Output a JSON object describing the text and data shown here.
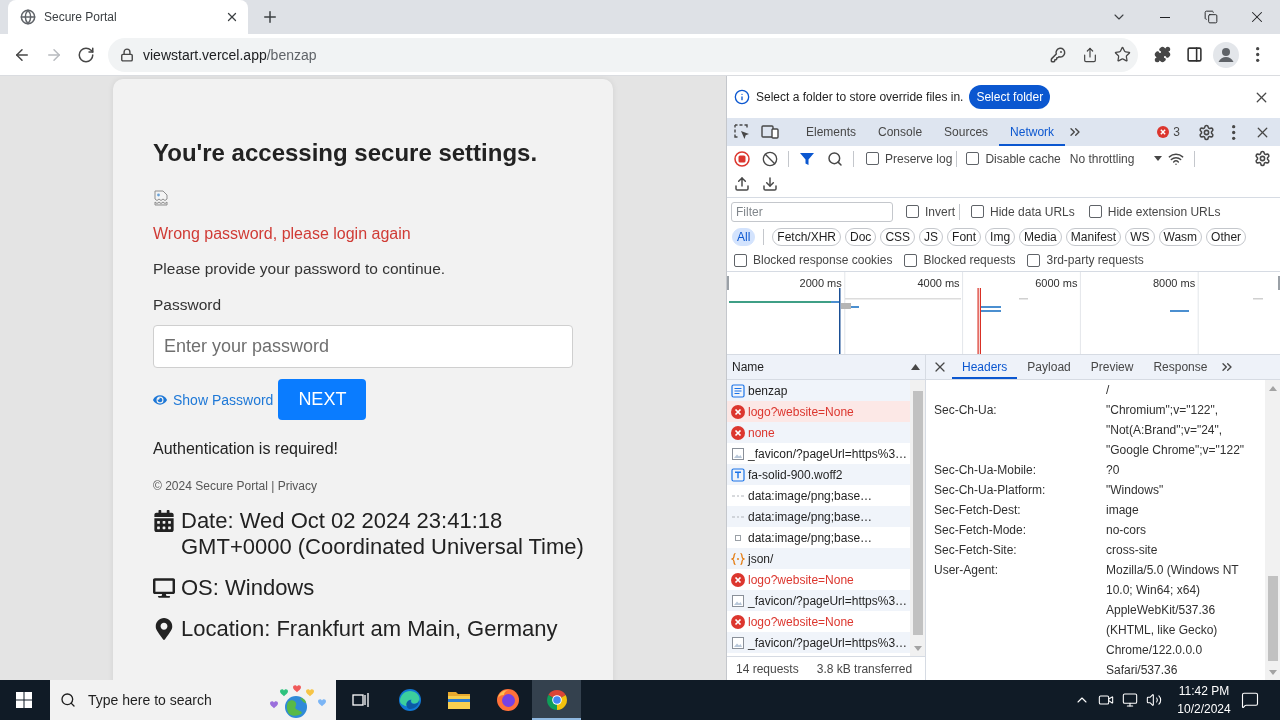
{
  "browser": {
    "tab_title": "Secure Portal",
    "nav": [
      {
        "kind": "back",
        "disabled": false
      },
      {
        "kind": "forward",
        "disabled": true
      },
      {
        "kind": "reload",
        "disabled": false
      }
    ],
    "url": {
      "host": "viewstart.vercel.app",
      "path": "/benzap"
    }
  },
  "page": {
    "heading": "You're accessing secure settings.",
    "error": "Wrong password, please login again",
    "instruction": "Please provide your password to continue.",
    "password": {
      "label": "Password",
      "placeholder": "Enter your password"
    },
    "show_password": "Show Password",
    "next": "NEXT",
    "notice": "Authentication is required!",
    "footer": "© 2024 Secure Portal | Privacy",
    "details": [
      {
        "kind": "date",
        "text": "Date: Wed Oct 02 2024 23:41:18 GMT+0000 (Coordinated Universal Time)"
      },
      {
        "kind": "os",
        "text": "OS: Windows"
      },
      {
        "kind": "location",
        "text": "Location: Frankfurt am Main, Germany"
      }
    ]
  },
  "devtools": {
    "infobar": {
      "message": "Select a folder to store override files in.",
      "button": "Select folder"
    },
    "tabs": [
      {
        "label": "Elements",
        "selected": false
      },
      {
        "label": "Console",
        "selected": false
      },
      {
        "label": "Sources",
        "selected": false
      },
      {
        "label": "Network",
        "selected": true
      }
    ],
    "error_count": "3",
    "toolbar": {
      "options": [
        {
          "label": "Preserve log",
          "checked": false
        },
        {
          "label": "Disable cache",
          "checked": false
        }
      ],
      "throttling": "No throttling"
    },
    "filter": {
      "placeholder": "Filter",
      "options": [
        {
          "label": "Invert",
          "checked": false
        },
        {
          "label": "Hide data URLs",
          "checked": false
        },
        {
          "label": "Hide extension URLs",
          "checked": false
        }
      ]
    },
    "types": [
      {
        "label": "All",
        "selected": true
      },
      {
        "label": "Fetch/XHR",
        "selected": false
      },
      {
        "label": "Doc",
        "selected": false
      },
      {
        "label": "CSS",
        "selected": false
      },
      {
        "label": "JS",
        "selected": false
      },
      {
        "label": "Font",
        "selected": false
      },
      {
        "label": "Img",
        "selected": false
      },
      {
        "label": "Media",
        "selected": false
      },
      {
        "label": "Manifest",
        "selected": false
      },
      {
        "label": "WS",
        "selected": false
      },
      {
        "label": "Wasm",
        "selected": false
      },
      {
        "label": "Other",
        "selected": false
      }
    ],
    "more_options": [
      {
        "label": "Blocked response cookies",
        "checked": false
      },
      {
        "label": "Blocked requests",
        "checked": false
      },
      {
        "label": "3rd-party requests",
        "checked": false
      }
    ],
    "overview": {
      "ticks": [
        "2000 ms",
        "4000 ms",
        "6000 ms",
        "8000 ms"
      ]
    },
    "requests": {
      "column": "Name",
      "rows": [
        {
          "name": "benzap",
          "kind": "document",
          "selected": false
        },
        {
          "name": "logo?website=None",
          "kind": "error",
          "selected": true
        },
        {
          "name": "none",
          "kind": "error",
          "selected": false
        },
        {
          "name": "_favicon/?pageUrl=https%3…",
          "kind": "image",
          "selected": false
        },
        {
          "name": "fa-solid-900.woff2",
          "kind": "font",
          "selected": false
        },
        {
          "name": "data:image/png;base…",
          "kind": "data",
          "selected": false
        },
        {
          "name": "data:image/png;base…",
          "kind": "data",
          "selected": false
        },
        {
          "name": "data:image/png;base…",
          "kind": "thumbnail",
          "selected": false
        },
        {
          "name": "json/",
          "kind": "json",
          "selected": false
        },
        {
          "name": "logo?website=None",
          "kind": "error",
          "selected": false
        },
        {
          "name": "_favicon/?pageUrl=https%3…",
          "kind": "image",
          "selected": false
        },
        {
          "name": "logo?website=None",
          "kind": "error",
          "selected": false
        },
        {
          "name": "_favicon/?pageUrl=https%3…",
          "kind": "image",
          "selected": false
        }
      ],
      "summary": [
        "14 requests",
        "3.8 kB transferred"
      ]
    },
    "details": {
      "tabs": [
        {
          "label": "Headers",
          "selected": true
        },
        {
          "label": "Payload",
          "selected": false
        },
        {
          "label": "Preview",
          "selected": false
        },
        {
          "label": "Response",
          "selected": false
        }
      ],
      "headers": [
        {
          "value": "/"
        },
        {
          "name": "Sec-Ch-Ua:",
          "value": "\"Chromium\";v=\"122\", \"Not(A:Brand\";v=\"24\", \"Google Chrome\";v=\"122\""
        },
        {
          "name": "Sec-Ch-Ua-Mobile:",
          "value": "?0"
        },
        {
          "name": "Sec-Ch-Ua-Platform:",
          "value": "\"Windows\""
        },
        {
          "name": "Sec-Fetch-Dest:",
          "value": "image"
        },
        {
          "name": "Sec-Fetch-Mode:",
          "value": "no-cors"
        },
        {
          "name": "Sec-Fetch-Site:",
          "value": "cross-site"
        },
        {
          "name": "User-Agent:",
          "value": "Mozilla/5.0 (Windows NT 10.0; Win64; x64) AppleWebKit/537.36 (KHTML, like Gecko) Chrome/122.0.0.0 Safari/537.36"
        }
      ]
    }
  },
  "taskbar": {
    "search_placeholder": "Type here to search",
    "apps": [
      {
        "kind": "edge",
        "active": false
      },
      {
        "kind": "explorer",
        "active": false
      },
      {
        "kind": "firefox",
        "active": false
      },
      {
        "kind": "chrome",
        "active": true
      }
    ],
    "time": "11:42 PM",
    "date": "10/2/2024"
  }
}
